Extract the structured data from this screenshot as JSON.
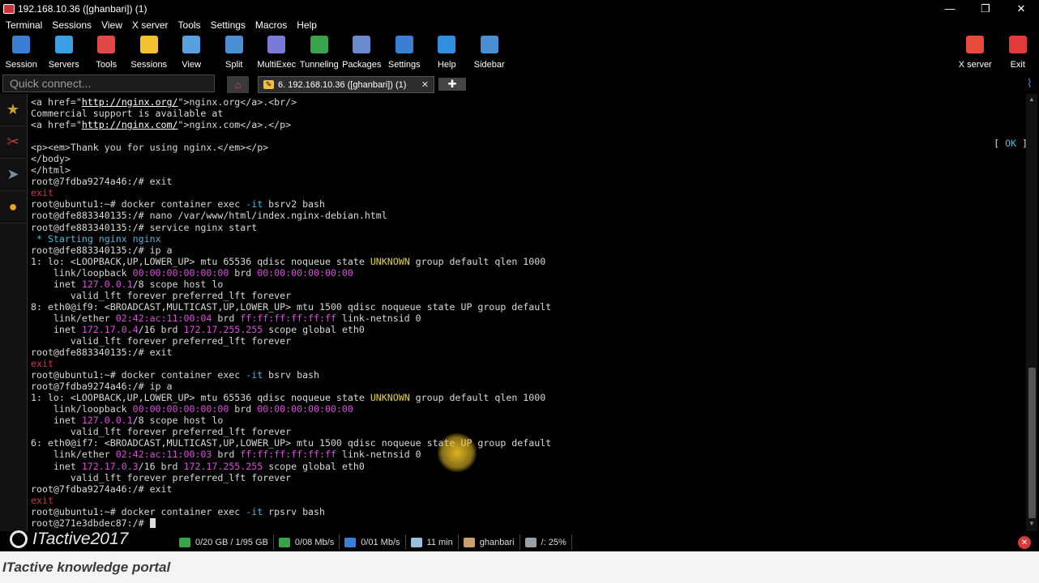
{
  "window": {
    "title": "192.168.10.36 ([ghanbari]) (1)",
    "controls": [
      "—",
      "❐",
      "✕"
    ]
  },
  "menu": [
    "Terminal",
    "Sessions",
    "View",
    "X server",
    "Tools",
    "Settings",
    "Macros",
    "Help"
  ],
  "toolbar": [
    {
      "label": "Session",
      "icon": "session-icon",
      "color": "#3b7fd4"
    },
    {
      "label": "Servers",
      "icon": "servers-icon",
      "color": "#3b9fe4"
    },
    {
      "label": "Tools",
      "icon": "tools-icon",
      "color": "#e24848"
    },
    {
      "label": "Sessions",
      "icon": "star-icon",
      "color": "#f2c230"
    },
    {
      "label": "View",
      "icon": "view-icon",
      "color": "#5aa0e0"
    },
    {
      "label": "Split",
      "icon": "split-icon",
      "color": "#4a8fd4"
    },
    {
      "label": "MultiExec",
      "icon": "multiexec-icon",
      "color": "#7a7ad8"
    },
    {
      "label": "Tunneling",
      "icon": "tunneling-icon",
      "color": "#3aa24a"
    },
    {
      "label": "Packages",
      "icon": "packages-icon",
      "color": "#6a8ad0"
    },
    {
      "label": "Settings",
      "icon": "settings-icon",
      "color": "#3b7fd4"
    },
    {
      "label": "Help",
      "icon": "help-icon",
      "color": "#2f8ee0"
    },
    {
      "label": "Sidebar",
      "icon": "sidebar-icon",
      "color": "#4a8fd4"
    }
  ],
  "toolbar_right": [
    {
      "label": "X server",
      "icon": "x-server-icon",
      "color": "#e64a3a"
    },
    {
      "label": "Exit",
      "icon": "exit-icon",
      "color": "#e03a3a"
    }
  ],
  "quick_connect": {
    "placeholder": "Quick connect..."
  },
  "tab": {
    "label": "6. 192.168.10.36 ([ghanbari]) (1)",
    "close": "✕"
  },
  "terminal_lines": [
    [
      {
        "t": "<a href=\""
      },
      {
        "t": "http://nginx.org/",
        "c": "t-link"
      },
      {
        "t": "\">nginx.org</a>.<br/>"
      }
    ],
    [
      {
        "t": "Commercial support is available at"
      }
    ],
    [
      {
        "t": "<a href=\""
      },
      {
        "t": "http://nginx.com/",
        "c": "t-link"
      },
      {
        "t": "\">nginx.com</a>.</p>"
      }
    ],
    [
      {
        "t": ""
      }
    ],
    [
      {
        "t": "<p><em>Thank you for using nginx.</em></p>"
      }
    ],
    [
      {
        "t": "</body>"
      }
    ],
    [
      {
        "t": "</html>"
      }
    ],
    [
      {
        "t": "root@7fdba9274a46:/# exit"
      }
    ],
    [
      {
        "t": "exit",
        "c": "t-red"
      }
    ],
    [
      {
        "t": "root@ubuntu1:~# docker container exec "
      },
      {
        "t": "-it",
        "c": "t-cyan"
      },
      {
        "t": " bsrv2 bash"
      }
    ],
    [
      {
        "t": "root@dfe883340135:/# nano /var/www/html/index.nginx-debian.html"
      }
    ],
    [
      {
        "t": "root@dfe883340135:/# service nginx start"
      }
    ],
    [
      {
        "t": " * ",
        "c": "t-cyan"
      },
      {
        "t": "Starting nginx nginx",
        "c": "t-cyan"
      }
    ],
    [
      {
        "t": "root@dfe883340135:/# ip a"
      }
    ],
    [
      {
        "t": "1: lo: <LOOPBACK,UP,LOWER_UP> mtu 65536 qdisc noqueue state "
      },
      {
        "t": "UNKNOWN",
        "c": "t-yel"
      },
      {
        "t": " group default qlen 1000"
      }
    ],
    [
      {
        "t": "    link/loopback "
      },
      {
        "t": "00:00:00:00:00:00",
        "c": "t-mag"
      },
      {
        "t": " brd "
      },
      {
        "t": "00:00:00:00:00:00",
        "c": "t-mag"
      }
    ],
    [
      {
        "t": "    inet "
      },
      {
        "t": "127.0.0.1",
        "c": "t-mag"
      },
      {
        "t": "/8 scope host lo"
      }
    ],
    [
      {
        "t": "       valid_lft forever preferred_lft forever"
      }
    ],
    [
      {
        "t": "8: eth0@if9: <BROADCAST,MULTICAST,UP,LOWER_UP> mtu 1500 qdisc noqueue state UP group default"
      }
    ],
    [
      {
        "t": "    link/ether "
      },
      {
        "t": "02:42:ac:11:00:04",
        "c": "t-mag"
      },
      {
        "t": " brd "
      },
      {
        "t": "ff:ff:ff:ff:ff:ff",
        "c": "t-mag"
      },
      {
        "t": " link-netnsid 0"
      }
    ],
    [
      {
        "t": "    inet "
      },
      {
        "t": "172.17.0.4",
        "c": "t-mag"
      },
      {
        "t": "/16 brd "
      },
      {
        "t": "172.17.255.255",
        "c": "t-mag"
      },
      {
        "t": " scope global eth0"
      }
    ],
    [
      {
        "t": "       valid_lft forever preferred_lft forever"
      }
    ],
    [
      {
        "t": "root@dfe883340135:/# exit"
      }
    ],
    [
      {
        "t": "exit",
        "c": "t-red"
      }
    ],
    [
      {
        "t": "root@ubuntu1:~# docker container exec "
      },
      {
        "t": "-it",
        "c": "t-cyan"
      },
      {
        "t": " bsrv bash"
      }
    ],
    [
      {
        "t": "root@7fdba9274a46:/# ip a"
      }
    ],
    [
      {
        "t": "1: lo: <LOOPBACK,UP,LOWER_UP> mtu 65536 qdisc noqueue state "
      },
      {
        "t": "UNKNOWN",
        "c": "t-yel"
      },
      {
        "t": " group default qlen 1000"
      }
    ],
    [
      {
        "t": "    link/loopback "
      },
      {
        "t": "00:00:00:00:00:00",
        "c": "t-mag"
      },
      {
        "t": " brd "
      },
      {
        "t": "00:00:00:00:00:00",
        "c": "t-mag"
      }
    ],
    [
      {
        "t": "    inet "
      },
      {
        "t": "127.0.0.1",
        "c": "t-mag"
      },
      {
        "t": "/8 scope host lo"
      }
    ],
    [
      {
        "t": "       valid_lft forever preferred_lft forever"
      }
    ],
    [
      {
        "t": "6: eth0@if7: <BROADCAST,MULTICAST,UP,LOWER_UP> mtu 1500 qdisc noqueue state UP group default"
      }
    ],
    [
      {
        "t": "    link/ether "
      },
      {
        "t": "02:42:ac:11:00:03",
        "c": "t-mag"
      },
      {
        "t": " brd "
      },
      {
        "t": "ff:ff:ff:ff:ff:ff",
        "c": "t-mag"
      },
      {
        "t": " link-netnsid 0"
      }
    ],
    [
      {
        "t": "    inet "
      },
      {
        "t": "172.17.0.3",
        "c": "t-mag"
      },
      {
        "t": "/16 brd "
      },
      {
        "t": "172.17.255.255",
        "c": "t-mag"
      },
      {
        "t": " scope global eth0"
      }
    ],
    [
      {
        "t": "       valid_lft forever preferred_lft forever"
      }
    ],
    [
      {
        "t": "root@7fdba9274a46:/# exit"
      }
    ],
    [
      {
        "t": "exit",
        "c": "t-red"
      }
    ],
    [
      {
        "t": "root@ubuntu1:~# docker container exec "
      },
      {
        "t": "-it",
        "c": "t-cyan"
      },
      {
        "t": " rpsrv bash"
      }
    ],
    [
      {
        "t": "root@271e3dbdec87:/# "
      },
      {
        "t": "",
        "c": "cursor"
      }
    ]
  ],
  "ok_status": {
    "open": "[ ",
    "ok": "OK",
    "close": " ]"
  },
  "statusbar": [
    {
      "icon": "network-icon",
      "text": "0/20 GB / 1/95 GB",
      "color": "#3aa24a"
    },
    {
      "icon": "upload-icon",
      "text": "0/08 Mb/s",
      "color": "#3aa24a"
    },
    {
      "icon": "download-icon",
      "text": "0/01 Mb/s",
      "color": "#3b7fd4"
    },
    {
      "icon": "clock-icon",
      "text": "11 min",
      "color": "#9ac0e0"
    },
    {
      "icon": "user-icon",
      "text": "ghanbari",
      "color": "#c8a070"
    },
    {
      "icon": "disk-icon",
      "text": "/: 25%",
      "color": "#9aa0a8"
    }
  ],
  "watermark": {
    "text": "ITactive2017"
  },
  "footer": {
    "text": "ITactive knowledge portal"
  }
}
